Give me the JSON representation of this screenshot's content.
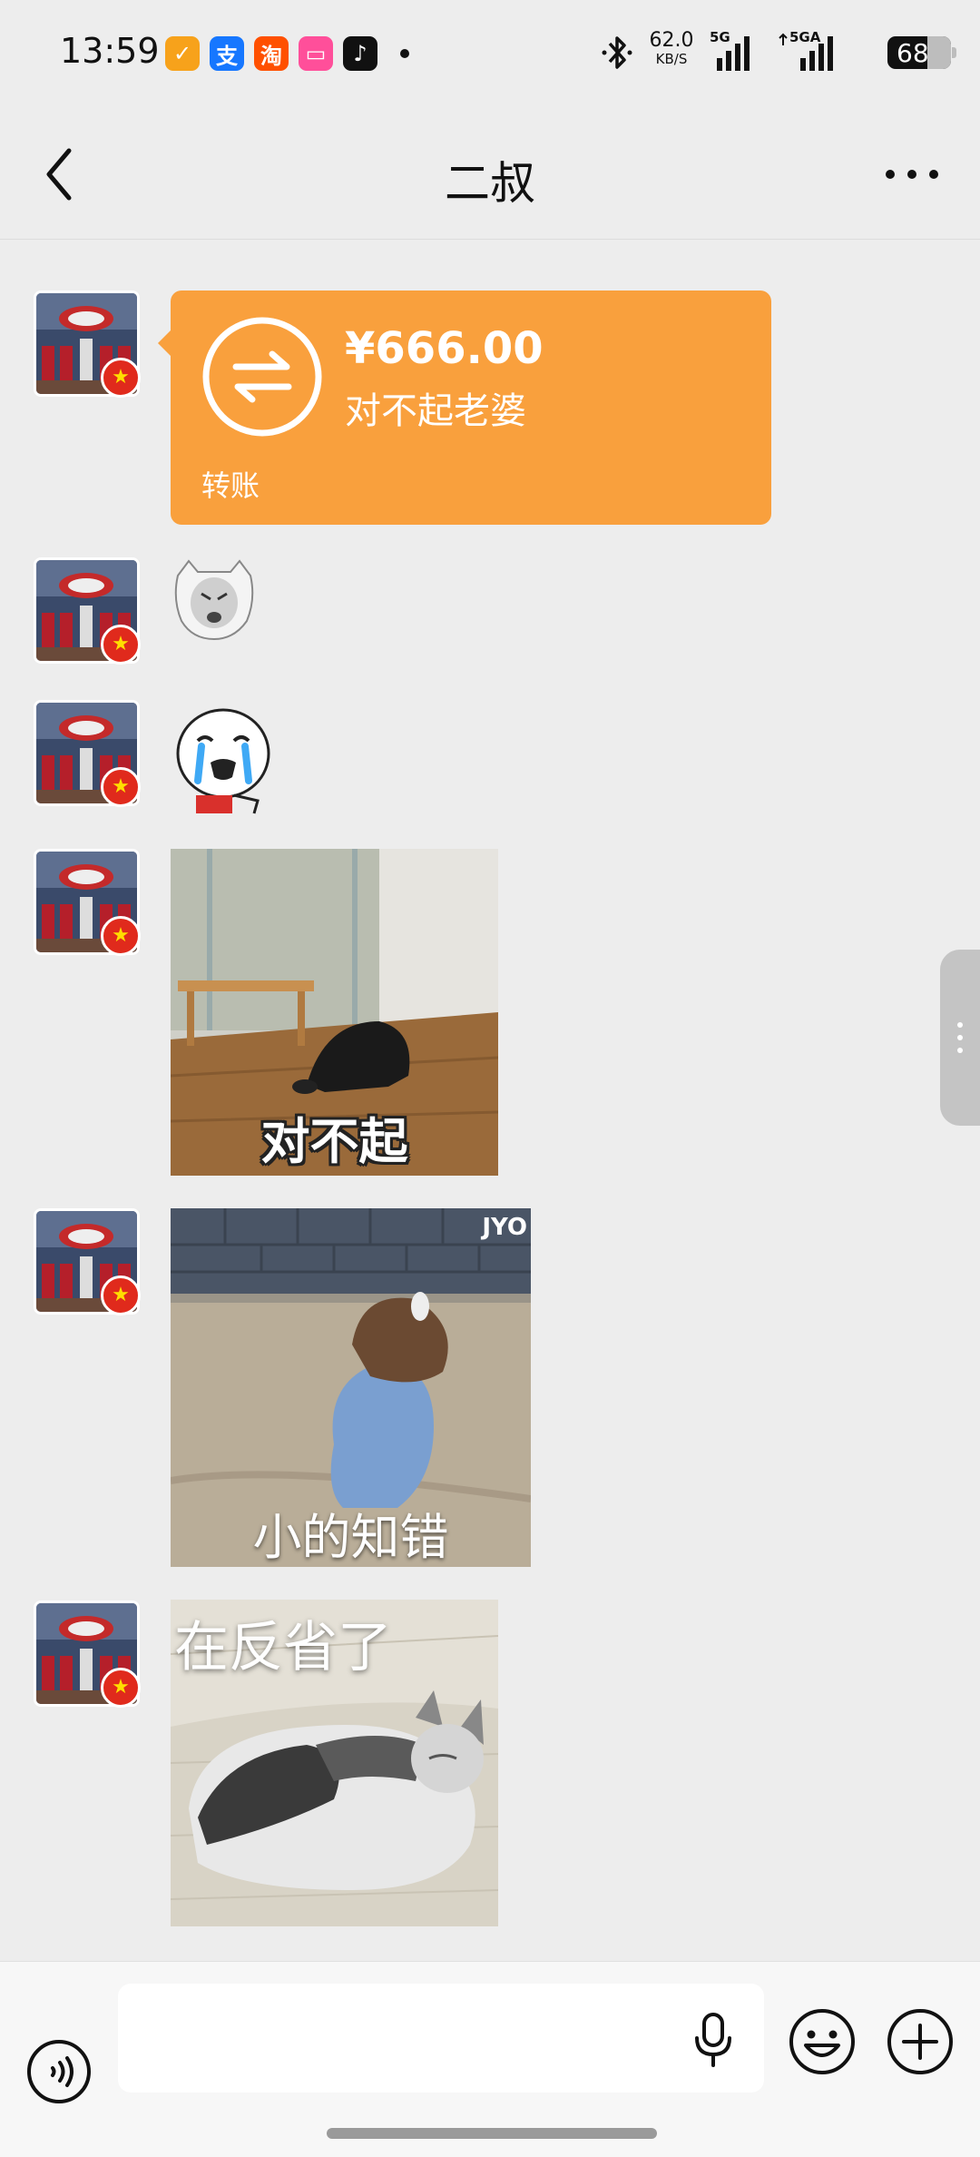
{
  "status_bar": {
    "time": "13:59",
    "app_icons": [
      {
        "name": "yellow-app-icon",
        "glyph": "✓",
        "color": "#f7a21b"
      },
      {
        "name": "alipay-icon",
        "glyph": "支",
        "color": "#1677ff"
      },
      {
        "name": "taobao-icon",
        "glyph": "淘",
        "color": "#ff5000"
      },
      {
        "name": "pink-app-icon",
        "glyph": "▭",
        "color": "#ff4f9a"
      },
      {
        "name": "tiktok-icon",
        "glyph": "♪",
        "color": "#111111"
      }
    ],
    "net_speed_value": "62.0",
    "net_speed_unit": "KB/S",
    "signal_1_label": "5G",
    "signal_2_label": "5GA",
    "battery": "68"
  },
  "nav": {
    "title": "二叔"
  },
  "messages": {
    "transfer": {
      "amount": "¥666.00",
      "note": "对不起老婆",
      "label": "转账"
    },
    "image1_caption": "对不起",
    "image2_caption": "小的知错",
    "image2_watermark": "JYO",
    "image3_caption": "在反省了"
  },
  "input_bar": {
    "placeholder": ""
  },
  "colors": {
    "transfer_orange": "#f9a03d",
    "background": "#ededed"
  }
}
